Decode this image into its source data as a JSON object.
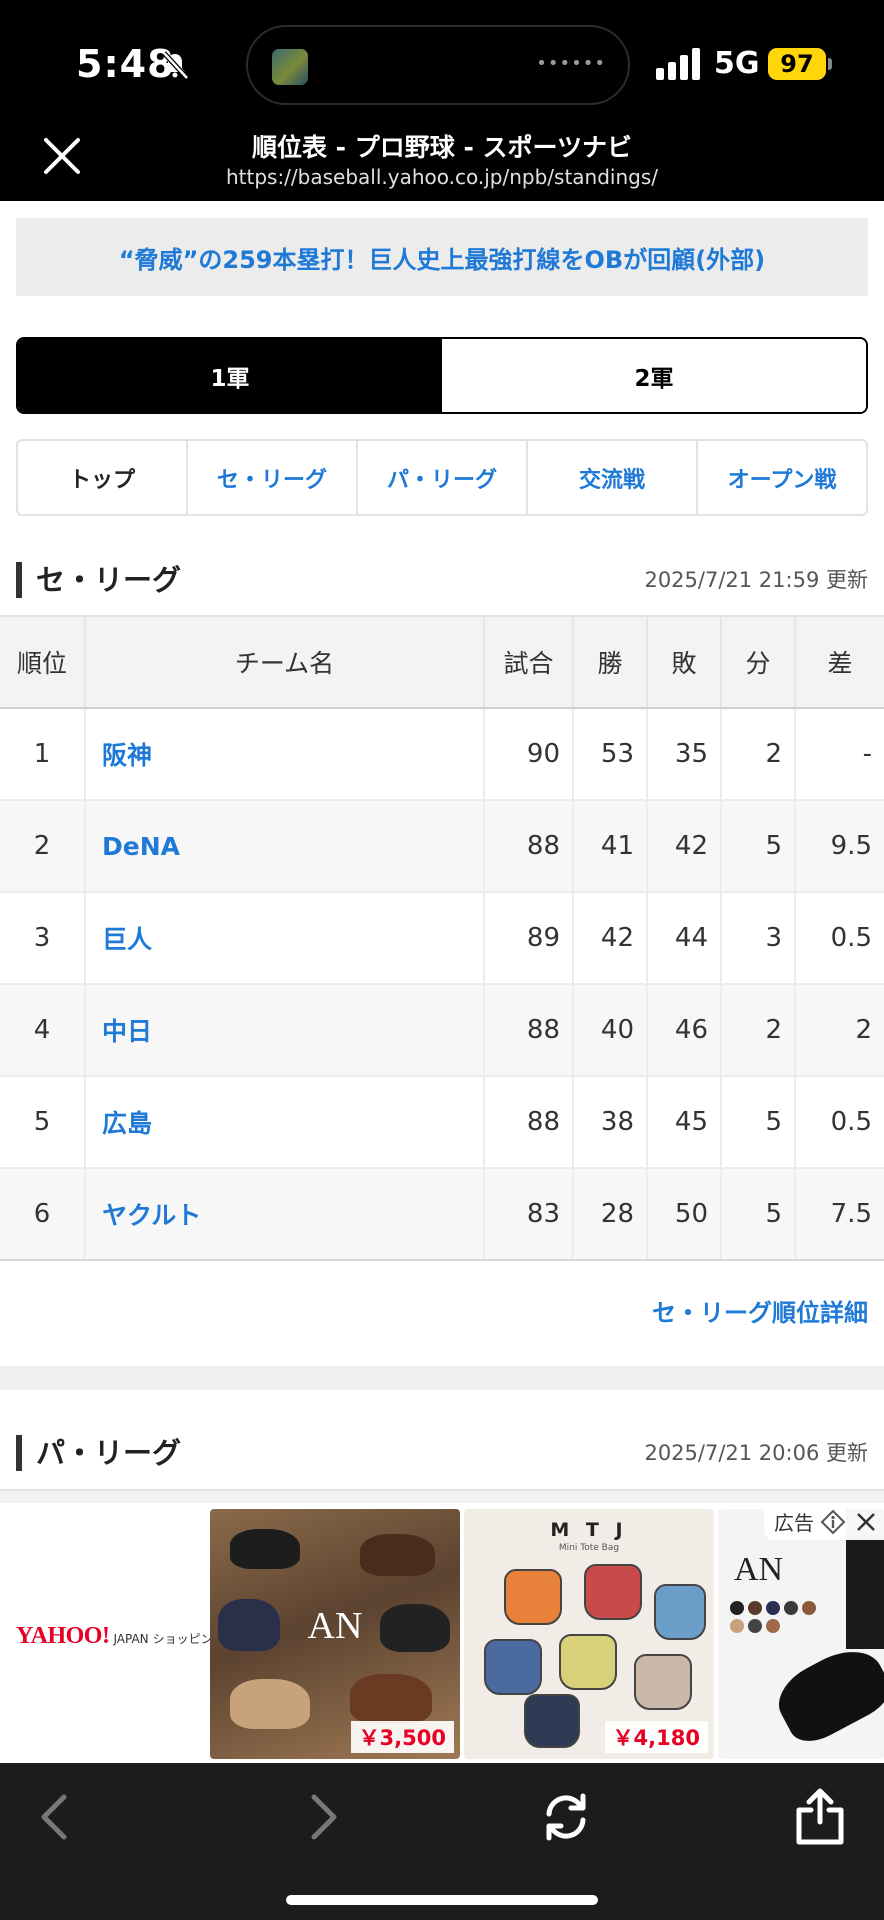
{
  "status_bar": {
    "time": "5:48",
    "network": "5G",
    "battery": "97"
  },
  "browser": {
    "title": "順位表 - プロ野球 - スポーツナビ",
    "url": "https://baseball.yahoo.co.jp/npb/standings/"
  },
  "news_banner": "“脅威”の259本塁打！巨人史上最強打線をOBが回顧(外部)",
  "team_toggle": [
    "1軍",
    "2軍"
  ],
  "league_tabs": [
    "トップ",
    "セ・リーグ",
    "パ・リーグ",
    "交流戦",
    "オープン戦"
  ],
  "central": {
    "title": "セ・リーグ",
    "updated": "2025/7/21 21:59 更新",
    "columns": [
      "順位",
      "チーム名",
      "試合",
      "勝",
      "敗",
      "分",
      "差"
    ],
    "rows": [
      {
        "rank": "1",
        "team": "阪神",
        "games": "90",
        "wins": "53",
        "losses": "35",
        "draws": "2",
        "gb": "-"
      },
      {
        "rank": "2",
        "team": "DeNA",
        "games": "88",
        "wins": "41",
        "losses": "42",
        "draws": "5",
        "gb": "9.5"
      },
      {
        "rank": "3",
        "team": "巨人",
        "games": "89",
        "wins": "42",
        "losses": "44",
        "draws": "3",
        "gb": "0.5"
      },
      {
        "rank": "4",
        "team": "中日",
        "games": "88",
        "wins": "40",
        "losses": "46",
        "draws": "2",
        "gb": "2"
      },
      {
        "rank": "5",
        "team": "広島",
        "games": "88",
        "wins": "38",
        "losses": "45",
        "draws": "5",
        "gb": "0.5"
      },
      {
        "rank": "6",
        "team": "ヤクルト",
        "games": "83",
        "wins": "28",
        "losses": "50",
        "draws": "5",
        "gb": "7.5"
      }
    ],
    "detail_link": "セ・リーグ順位詳細"
  },
  "pacific": {
    "title": "パ・リーグ",
    "updated": "2025/7/21 20:06 更新"
  },
  "ad": {
    "label": "広告",
    "logo": "YAHOO!",
    "logo_sub": "JAPAN",
    "logo_shop": "ショッピング",
    "card1_brand": "AN",
    "card1_price": "￥3,500",
    "card2_brand": "M T J",
    "card2_sub": "Mini Tote Bag",
    "card2_price": "￥4,180",
    "card3_brand": "AN"
  },
  "colors": {
    "link": "#1e7ad6",
    "battery": "#ffd60a",
    "ad_red": "#e60023"
  }
}
